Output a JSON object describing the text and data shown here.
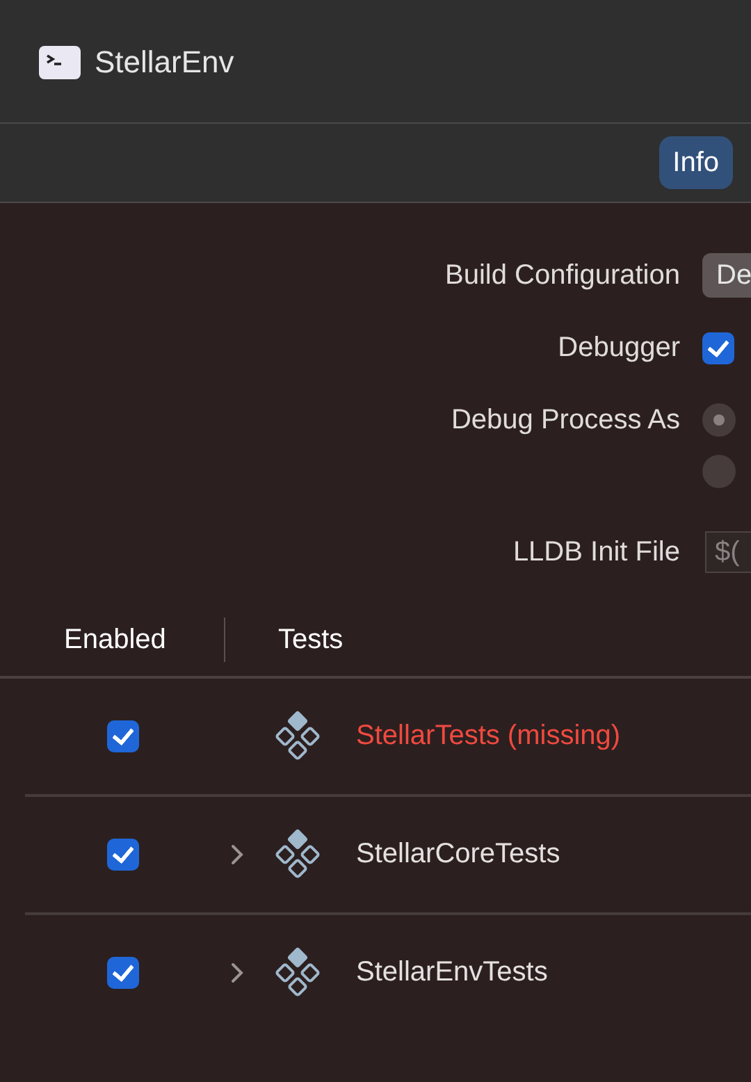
{
  "window": {
    "title": "StellarEnv"
  },
  "toolbar": {
    "tabs": [
      {
        "label": "Info",
        "selected": true
      }
    ]
  },
  "form": {
    "build_configuration": {
      "label": "Build Configuration",
      "value": "De"
    },
    "debugger": {
      "label": "Debugger",
      "checked": true
    },
    "debug_process_as": {
      "label": "Debug Process As",
      "options": [
        {
          "selected": true
        },
        {
          "selected": false
        }
      ]
    },
    "lldb_init_file": {
      "label": "LLDB Init File",
      "placeholder": "$("
    }
  },
  "tests_table": {
    "columns": [
      "Enabled",
      "Tests"
    ],
    "rows": [
      {
        "name": "StellarTests (missing)",
        "enabled": true,
        "missing": true,
        "has_children": false
      },
      {
        "name": "StellarCoreTests",
        "enabled": true,
        "missing": false,
        "has_children": true
      },
      {
        "name": "StellarEnvTests",
        "enabled": true,
        "missing": false,
        "has_children": true
      }
    ]
  }
}
